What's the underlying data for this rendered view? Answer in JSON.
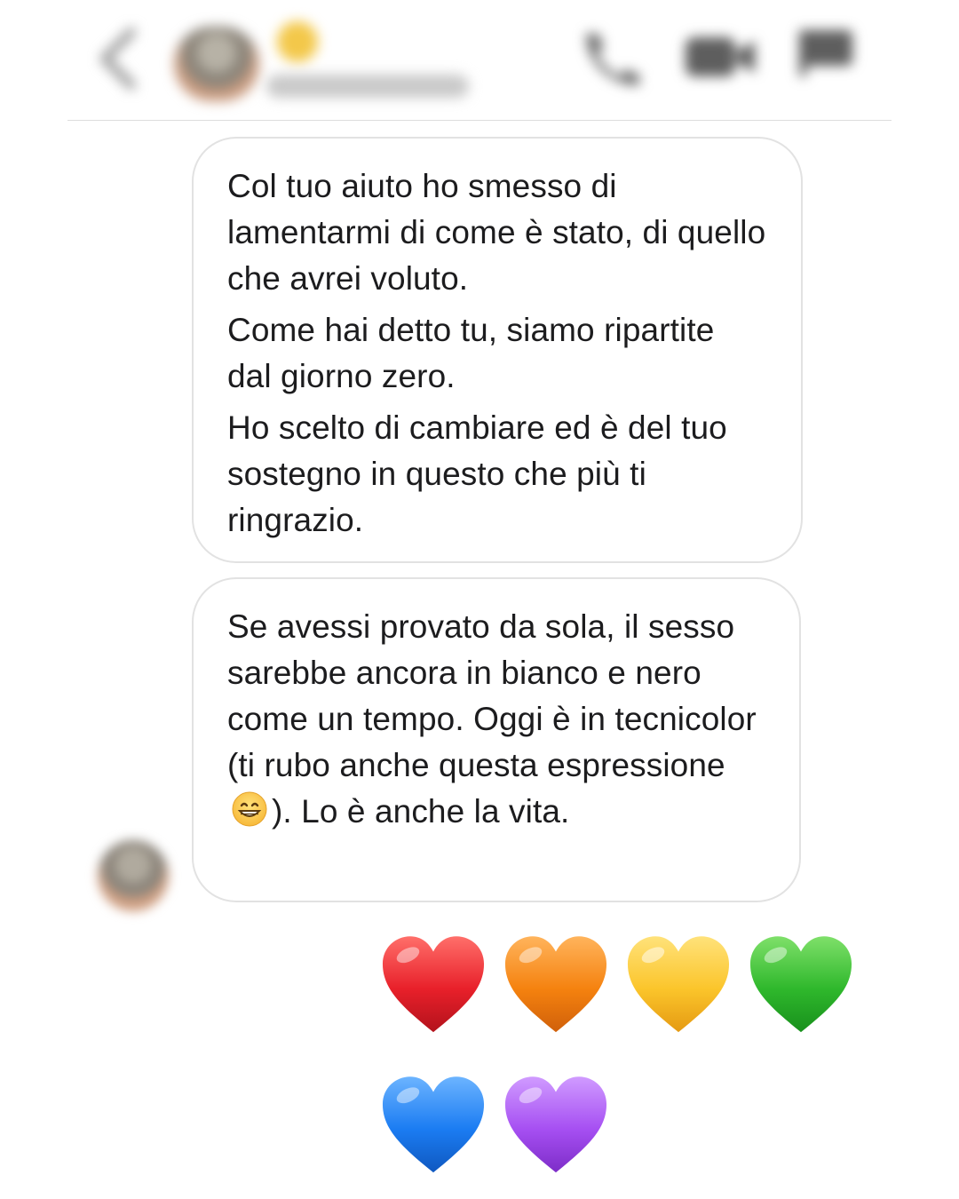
{
  "header": {
    "icons": [
      "back-icon",
      "call-icon",
      "video-call-icon",
      "flag-icon"
    ],
    "status_color": "#f3c84a"
  },
  "messages": [
    {
      "sender": "contact",
      "paragraphs": [
        "Col tuo aiuto ho smesso di lamentarmi di come è stato, di quello che avrei voluto.",
        "Come hai detto tu, siamo ripartite dal giorno zero.",
        "Ho scelto di cambiare ed è del tuo sostegno in questo che più ti ringrazio."
      ]
    },
    {
      "sender": "contact",
      "text_before_emoji": "Se avessi provato da sola, il sesso sarebbe ancora in bianco e nero come un tempo. Oggi è in tecnicolor (ti rubo anche questa espressione",
      "emoji": "grinning-face",
      "text_after_emoji": "). Lo è anche la vita."
    }
  ],
  "reaction_hearts": [
    {
      "name": "red-heart",
      "color": "#e8202a"
    },
    {
      "name": "orange-heart",
      "color": "#f5820f"
    },
    {
      "name": "yellow-heart",
      "color": "#fbc52b"
    },
    {
      "name": "green-heart",
      "color": "#2fb82c"
    },
    {
      "name": "blue-heart",
      "color": "#1b7cf2"
    },
    {
      "name": "purple-heart",
      "color": "#a64ff2"
    }
  ]
}
